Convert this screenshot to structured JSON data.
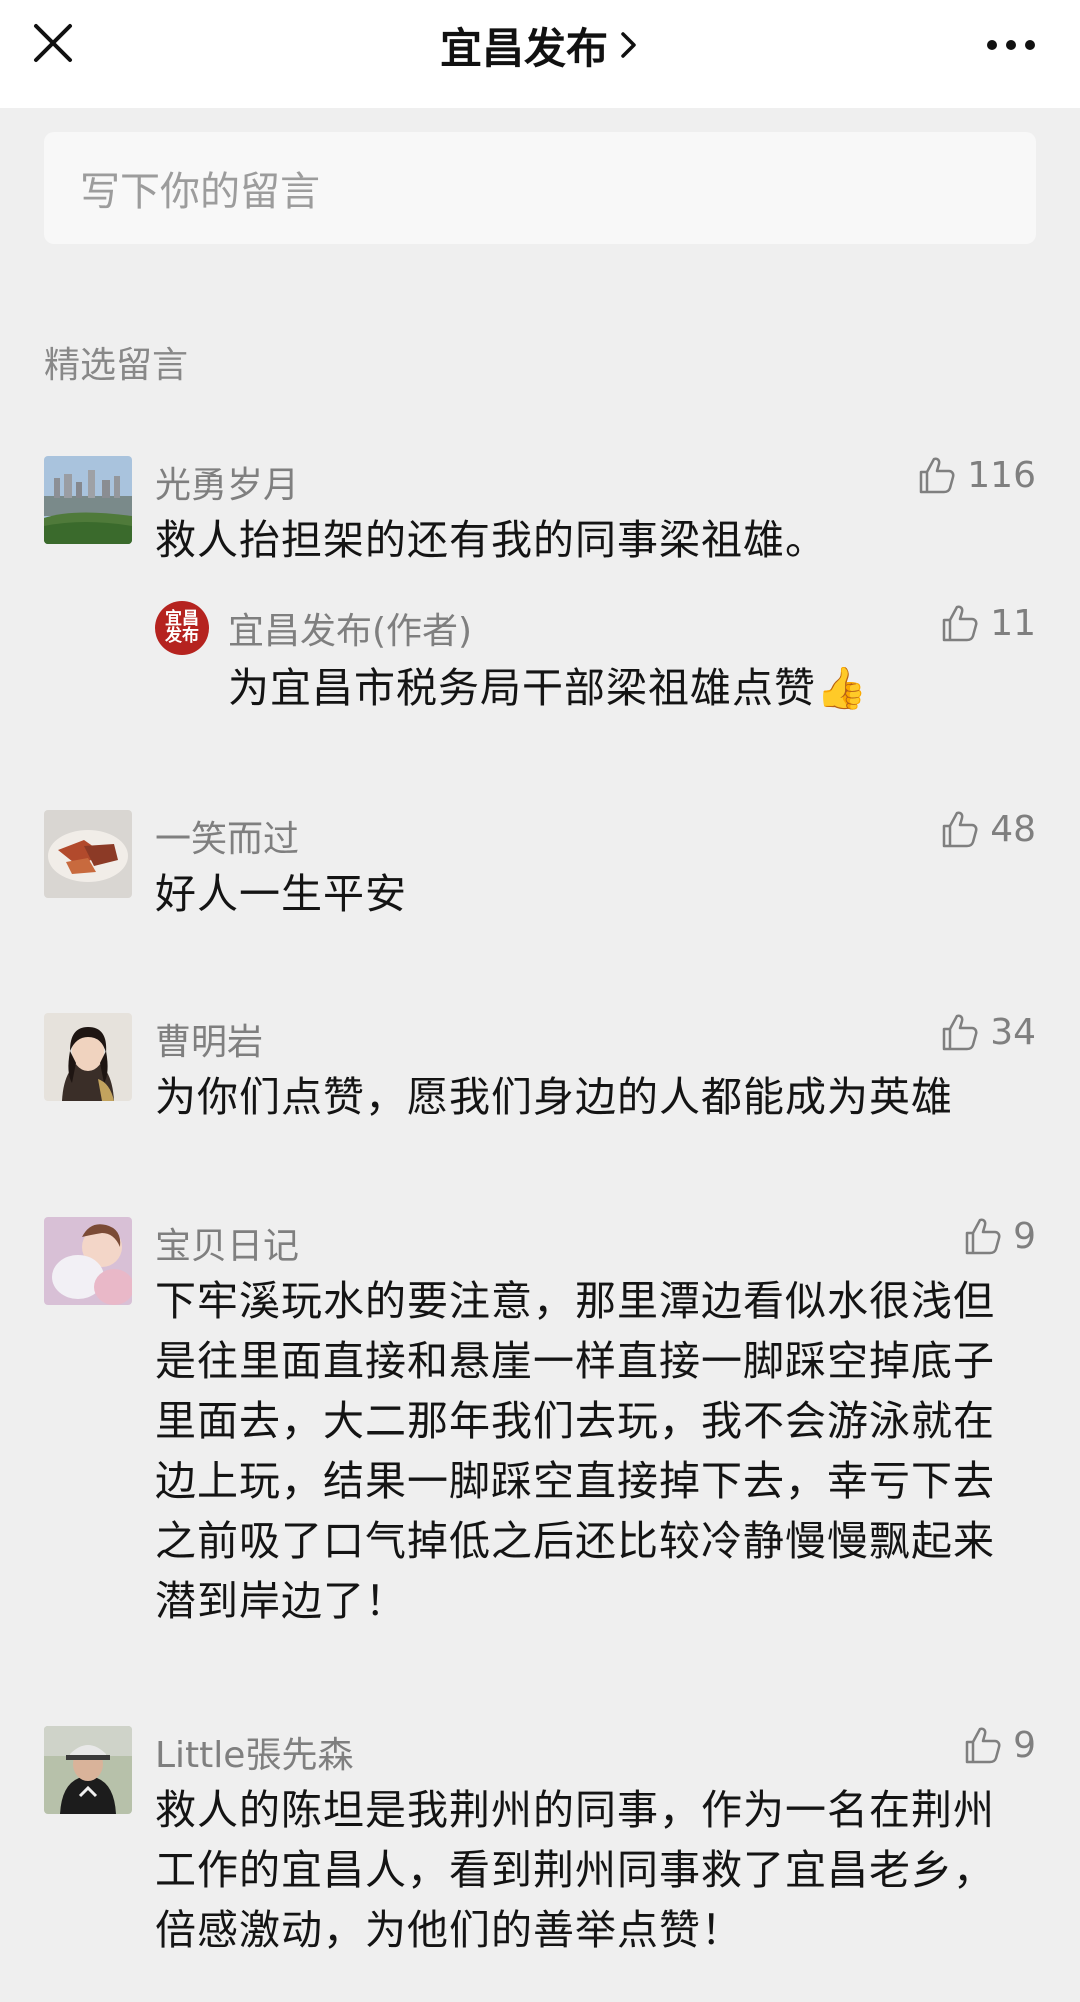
{
  "header": {
    "title": "宜昌发布"
  },
  "input": {
    "placeholder": "写下你的留言"
  },
  "section_title": "精选留言",
  "comments": [
    {
      "name": "光勇岁月",
      "likes": "116",
      "text": "救人抬担架的还有我的同事梁祖雄。",
      "reply": {
        "name": "宜昌发布(作者)",
        "likes": "11",
        "text": "为宜昌市税务局干部梁祖雄点赞👍",
        "avatar_text": "宜昌发布"
      }
    },
    {
      "name": "一笑而过",
      "likes": "48",
      "text": "好人一生平安"
    },
    {
      "name": "曹明岩",
      "likes": "34",
      "text": "为你们点赞，愿我们身边的人都能成为英雄"
    },
    {
      "name": "宝贝日记",
      "likes": "9",
      "text": "下牢溪玩水的要注意，那里潭边看似水很浅但是往里面直接和悬崖一样直接一脚踩空掉底子里面去，大二那年我们去玩，我不会游泳就在边上玩，结果一脚踩空直接掉下去，幸亏下去之前吸了口气掉低之后还比较冷静慢慢飘起来潜到岸边了！"
    },
    {
      "name": "Little張先森",
      "likes": "9",
      "text": "救人的陈坦是我荆州的同事，作为一名在荆州工作的宜昌人，看到荆州同事救了宜昌老乡，倍感激动，为他们的善举点赞！"
    }
  ]
}
